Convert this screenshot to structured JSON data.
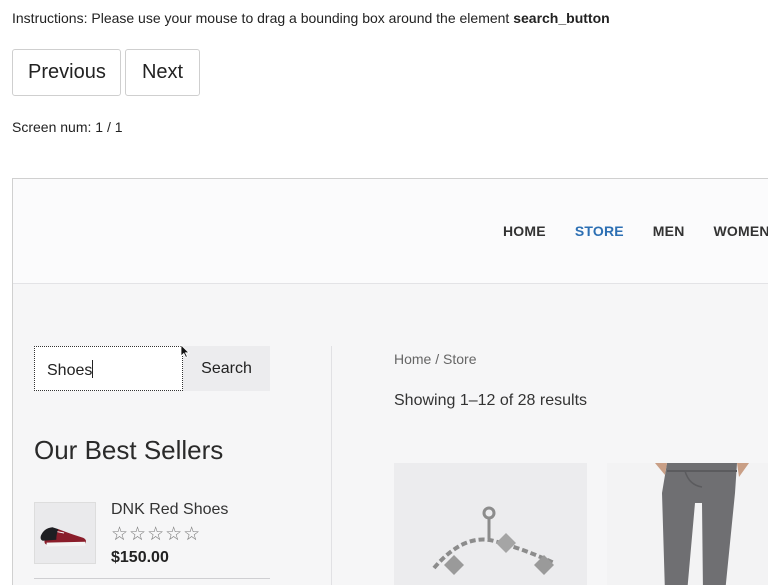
{
  "instructions": {
    "prefix": "Instructions:  Please use your mouse to drag a bounding box around the element ",
    "target": "search_button"
  },
  "navigation": {
    "previous_label": "Previous",
    "next_label": "Next"
  },
  "screen_num": {
    "label": "Screen num:  1 / 1"
  },
  "site": {
    "menu": [
      {
        "label": "HOME",
        "active": false
      },
      {
        "label": "STORE",
        "active": true
      },
      {
        "label": "MEN",
        "active": false
      },
      {
        "label": "WOMEN",
        "active": false
      }
    ],
    "accent_color": "#2c6fb3",
    "search": {
      "value": "Shoes",
      "button_label": "Search"
    },
    "sidebar": {
      "best_sellers_title": "Our Best Sellers",
      "product": {
        "name": "DNK Red Shoes",
        "stars": "☆☆☆☆☆",
        "price": "$150.00"
      }
    },
    "main": {
      "breadcrumb": "Home / Store",
      "results": "Showing 1–12 of 28 results"
    }
  }
}
